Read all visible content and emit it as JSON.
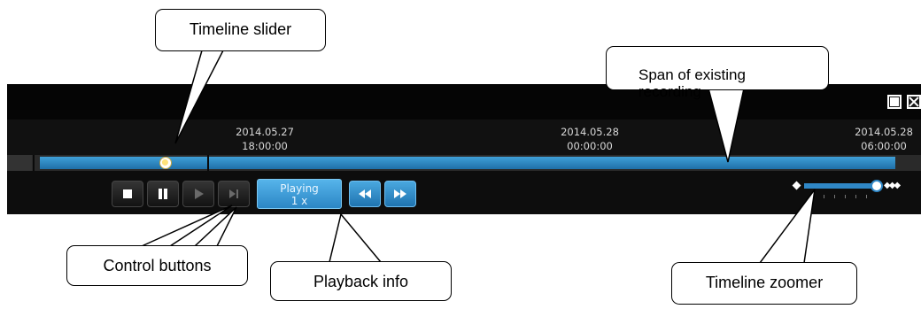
{
  "player": {
    "window_icons": [
      "window-mode-icon",
      "fullscreen-icon"
    ],
    "timeline": {
      "ticks": [
        {
          "date": "2014.05.27",
          "time": "18:00:00"
        },
        {
          "date": "2014.05.28",
          "time": "00:00:00"
        },
        {
          "date": "2014.05.28",
          "time": "06:00:00"
        }
      ]
    },
    "controls": {
      "buttons": [
        "stop-button",
        "pause-button",
        "play-button",
        "step-forward-button",
        "rewind-button",
        "fast-forward-button"
      ],
      "playback_status": "Playing",
      "playback_speed": "1 x"
    },
    "zoomer": {
      "level": 0.92
    }
  },
  "callouts": {
    "timeline_slider": "Timeline slider",
    "span_of_recording": "Span of existing\nrecording",
    "control_buttons": "Control buttons",
    "playback_info": "Playback info",
    "timeline_zoomer": "Timeline zoomer"
  },
  "colors": {
    "accent": "#2f87c6",
    "background_dark": "#0d0d0d",
    "playback_active": "#3fa0d8"
  }
}
